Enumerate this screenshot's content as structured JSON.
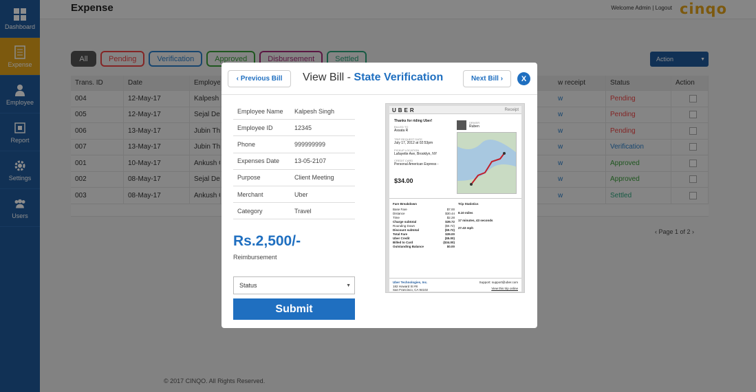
{
  "sidebar": {
    "items": [
      {
        "label": "Dashboard",
        "icon": "dashboard-icon"
      },
      {
        "label": "Expense",
        "icon": "receipt-icon",
        "active": true
      },
      {
        "label": "Employee",
        "icon": "person-icon"
      },
      {
        "label": "Report",
        "icon": "report-icon"
      },
      {
        "label": "Settings",
        "icon": "gear-icon"
      },
      {
        "label": "Users",
        "icon": "users-icon"
      }
    ]
  },
  "header": {
    "title": "Expense",
    "welcome": "Welcome Admin | Logout",
    "logo": "cinqo"
  },
  "filters": {
    "all": "All",
    "pending": "Pending",
    "verification": "Verification",
    "approved": "Approved",
    "disbursement": "Disbursement",
    "settled": "Settled"
  },
  "action_button": "Action",
  "table": {
    "headers": [
      "Trans. ID",
      "Date",
      "Employe",
      "w receipt",
      "Status",
      "Action"
    ],
    "rows": [
      {
        "id": "004",
        "date": "12-May-17",
        "emp": "Kalpesh",
        "receipt": "w",
        "status": "Pending",
        "status_class": "st-pending"
      },
      {
        "id": "005",
        "date": "12-May-17",
        "emp": "Sejal Des",
        "receipt": "w",
        "status": "Pending",
        "status_class": "st-pending"
      },
      {
        "id": "006",
        "date": "13-May-17",
        "emp": "Jubin Th",
        "receipt": "w",
        "status": "Pending",
        "status_class": "st-pending"
      },
      {
        "id": "007",
        "date": "13-May-17",
        "emp": "Jubin Th",
        "receipt": "w",
        "status": "Verification",
        "status_class": "st-verif"
      },
      {
        "id": "001",
        "date": "10-May-17",
        "emp": "Ankush C",
        "receipt": "w",
        "status": "Approved",
        "status_class": "st-appr"
      },
      {
        "id": "002",
        "date": "08-May-17",
        "emp": "Sejal Des",
        "receipt": "w",
        "status": "Approved",
        "status_class": "st-appr"
      },
      {
        "id": "003",
        "date": "08-May-17",
        "emp": "Ankush C",
        "receipt": "w",
        "status": "Settled",
        "status_class": "st-settled"
      }
    ]
  },
  "pager": "‹ Page 1 of 2 ›",
  "footer": "© 2017 CINQO. All Rights Reserved.",
  "modal": {
    "prev": "‹ Previous Bill",
    "next": "Next Bill ›",
    "title_prefix": "View Bill - ",
    "title_highlight": "State Verification",
    "close": "X",
    "details": [
      {
        "k": "Employee Name",
        "v": "Kalpesh Singh"
      },
      {
        "k": "Employee ID",
        "v": "12345"
      },
      {
        "k": "Phone",
        "v": "999999999"
      },
      {
        "k": "Expenses Date",
        "v": "13-05-2107"
      },
      {
        "k": "Purpose",
        "v": "Client Meeting"
      },
      {
        "k": "Merchant",
        "v": "Uber"
      },
      {
        "k": "Category",
        "v": "Travel"
      }
    ],
    "amount": "Rs.2,500/-",
    "amount_label": "Reimbursement",
    "status_placeholder": "Status",
    "submit": "Submit"
  },
  "receipt": {
    "brand": "UBER",
    "label": "Receipt",
    "thanks": "Thanks for riding Uber!",
    "rider_label": "BILLED TO",
    "rider": "Assata R",
    "driver_label": "DRIVER",
    "driver": "Ruben",
    "date_label": "TRIP REQUEST DATE",
    "date": "July 17, 2012 at 02:53pm",
    "pickup_label": "PICKUP LOCATION",
    "pickup": "Lafayette Ave, Brooklyn, NY",
    "card_label": "CREDIT CARD",
    "card": "Personal American Express -",
    "total": "$34.00",
    "fare_title": "Fare Breakdown",
    "fare": [
      {
        "k": "Base Fare",
        "v": "$7.00"
      },
      {
        "k": "Distance",
        "v": "$30.44"
      },
      {
        "k": "Time",
        "v": "$2.28"
      },
      {
        "k": "Charge subtotal",
        "v": "$39.72",
        "bold": true
      },
      {
        "k": "Rounding Down",
        "v": "($0.72)"
      },
      {
        "k": "Discount subtotal",
        "v": "($0.72)",
        "bold": true
      },
      {
        "k": "Total Fare",
        "v": "$39.00",
        "bold": true
      },
      {
        "k": "Uber Credit",
        "v": "($5.00)",
        "bold": true
      },
      {
        "k": "Billed to Card",
        "v": "($34.00)",
        "bold": true
      },
      {
        "k": "Outstanding Balance",
        "v": "$0.00",
        "bold": true
      }
    ],
    "trip_title": "Trip Statistics",
    "distance": "8.10 miles",
    "duration": "17 minutes, 43 seconds",
    "speed": "27.43 mph",
    "company": "Uber Technologies, Inc.",
    "address1": "182 Howard St #8",
    "address2": "San Francisco, CA 94102",
    "support": "Support: support@uber.com",
    "view_online": "View this trip online"
  }
}
